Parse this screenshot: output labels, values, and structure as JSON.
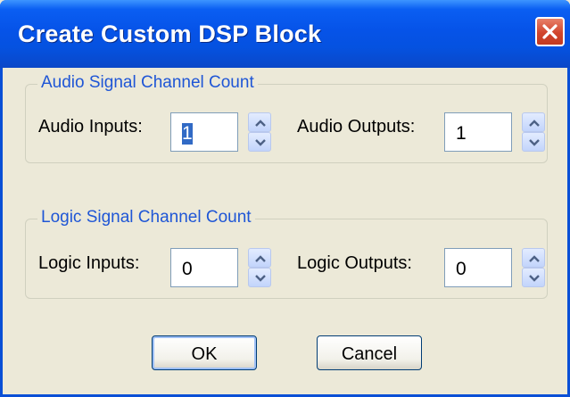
{
  "window": {
    "title": "Create Custom DSP Block"
  },
  "audio_group": {
    "label": "Audio Signal Channel Count",
    "inputs_label": "Audio Inputs:",
    "inputs_value": "1",
    "outputs_label": "Audio Outputs:",
    "outputs_value": "1"
  },
  "logic_group": {
    "label": "Logic Signal Channel Count",
    "inputs_label": "Logic Inputs:",
    "inputs_value": "0",
    "outputs_label": "Logic Outputs:",
    "outputs_value": "0"
  },
  "buttons": {
    "ok": "OK",
    "cancel": "Cancel"
  },
  "colors": {
    "titlebar": "#0653e8",
    "group_label": "#1f56d6",
    "close": "#d1452c",
    "dialog_bg": "#ece9d8"
  },
  "icons": [
    "close-icon",
    "spin-up-arrow-icon",
    "spin-down-arrow-icon"
  ]
}
